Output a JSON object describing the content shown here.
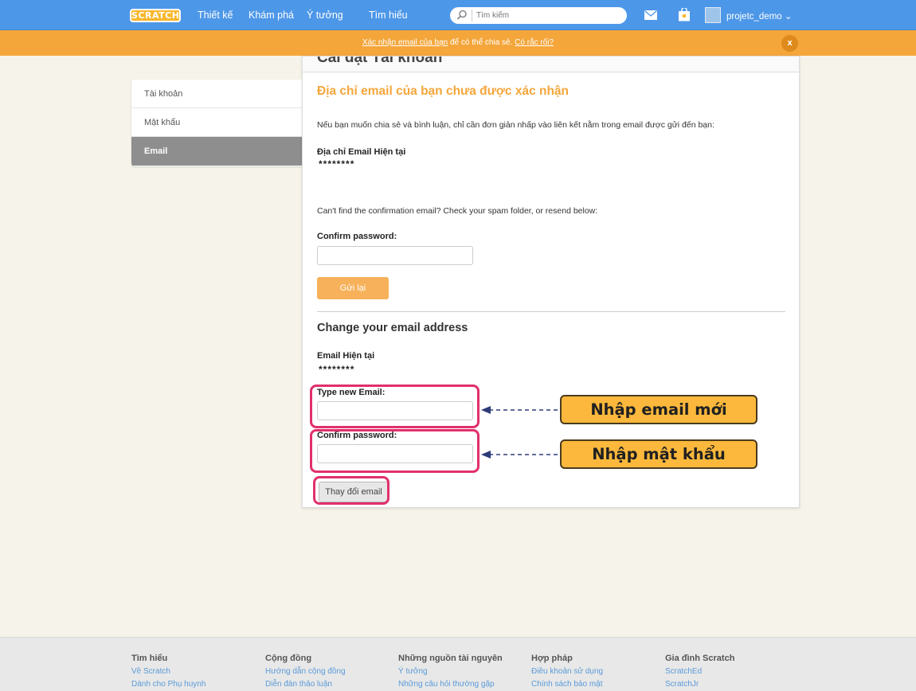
{
  "nav": {
    "logo": "SCRATCH",
    "links": [
      "Thiết kế",
      "Khám phá",
      "Ý tưởng",
      "Tìm hiểu"
    ],
    "search_placeholder": "Tìm kiếm",
    "username": "projetc_demo ⌄",
    "icons": [
      "search-icon",
      "mail-icon",
      "bag-icon",
      "avatar"
    ]
  },
  "banner": {
    "link1": "Xác nhận email của bạn",
    "middle": " để có thể chia sẻ. ",
    "link2": "Có rắc rối?",
    "close": "x",
    "color": "#f4a63b"
  },
  "sidebar": {
    "items": [
      {
        "label": "Tài khoản"
      },
      {
        "label": "Mật khẩu"
      },
      {
        "label": "Email"
      }
    ],
    "active": "Email"
  },
  "panel": {
    "header": "Cài đặt Tài khoản",
    "warning_title": "Địa chỉ email của bạn chưa được xác nhận",
    "info": "Nếu bạn muốn chia sẻ và bình luận, chỉ cần đơn giản nhấp vào liên kết nằm trong email được gửi đến bạn:",
    "current_email_label": "Địa chỉ Email Hiện tại",
    "current_email_value": "********",
    "resend_hint": "Can't find the confirmation email? Check your spam folder, or resend below:",
    "confirm_password_label": "Confirm password:",
    "resend_button": "Gửi lại",
    "change_title": "Change your email address",
    "current_email_label2": "Email Hiện tại",
    "current_email_value2": "********",
    "new_email_label": "Type new Email:",
    "confirm_password_label2": "Confirm password:",
    "change_button": "Thay đổi email"
  },
  "annotations": {
    "callout_email": "Nhập email mới",
    "callout_password": "Nhập mật khẩu",
    "highlight_color": "#e1306c",
    "callout_color": "#fbb83c"
  },
  "footer": {
    "columns": [
      {
        "title": "Tìm hiểu",
        "links": [
          "Về Scratch",
          "Dành cho Phụ huynh"
        ]
      },
      {
        "title": "Cộng đồng",
        "links": [
          "Hướng dẫn cộng đồng",
          "Diễn đàn thảo luận"
        ]
      },
      {
        "title": "Những nguồn tài nguyên",
        "links": [
          "Ý tưởng",
          "Những câu hỏi thường gặp"
        ]
      },
      {
        "title": "Hợp pháp",
        "links": [
          "Điều khoản sử dụng",
          "Chính sách bảo mật"
        ]
      },
      {
        "title": "Gia đình Scratch",
        "links": [
          "ScratchEd",
          "ScratchJr"
        ]
      }
    ]
  }
}
